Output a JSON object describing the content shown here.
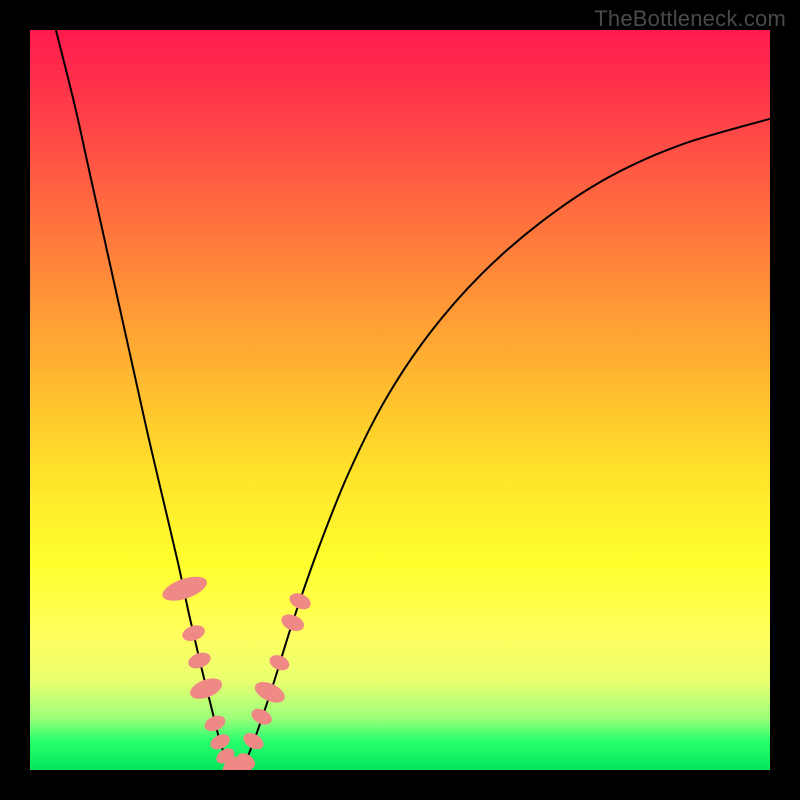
{
  "watermark": "TheBottleneck.com",
  "colors": {
    "background_frame": "#000000",
    "gradient_top": "#ff1a4d",
    "gradient_bottom": "#00e65c",
    "curve": "#000000",
    "marker": "#ef8985"
  },
  "chart_data": {
    "type": "line",
    "title": "",
    "xlabel": "",
    "ylabel": "",
    "xlim": [
      0,
      100
    ],
    "ylim": [
      0,
      100
    ],
    "series": [
      {
        "name": "left-curve",
        "x": [
          3.5,
          6,
          8,
          10,
          12,
          14,
          16,
          18,
          20,
          21.5,
          23,
          24.5,
          25.5,
          26.5,
          27.3
        ],
        "y": [
          100,
          90,
          81,
          72,
          63,
          54,
          45,
          36.5,
          28,
          21,
          14.5,
          8.5,
          4.5,
          1.5,
          0
        ]
      },
      {
        "name": "right-curve",
        "x": [
          28.5,
          29.5,
          31,
          33,
          35.5,
          39,
          43,
          48,
          54,
          61,
          69,
          78,
          88,
          100
        ],
        "y": [
          0,
          2,
          6,
          12,
          20,
          30,
          40,
          50,
          59,
          67,
          74,
          80,
          84.5,
          88
        ]
      }
    ],
    "floor_segment": {
      "x1": 27.3,
      "x2": 28.5,
      "y": 0
    },
    "markers_left_curve": [
      {
        "x": 20.9,
        "y": 24.5,
        "rx": 3.8,
        "ry": 9,
        "rot": 71
      },
      {
        "x": 22.1,
        "y": 18.5,
        "rx": 2.8,
        "ry": 4.5,
        "rot": 71
      },
      {
        "x": 22.9,
        "y": 14.8,
        "rx": 2.8,
        "ry": 4.5,
        "rot": 70
      },
      {
        "x": 23.8,
        "y": 11.0,
        "rx": 3.4,
        "ry": 6.5,
        "rot": 69
      },
      {
        "x": 25.0,
        "y": 6.3,
        "rx": 2.7,
        "ry": 4.2,
        "rot": 67
      },
      {
        "x": 25.7,
        "y": 3.8,
        "rx": 2.6,
        "ry": 4.0,
        "rot": 64
      },
      {
        "x": 26.4,
        "y": 1.9,
        "rx": 2.5,
        "ry": 3.8,
        "rot": 58
      }
    ],
    "markers_right_curve": [
      {
        "x": 29.2,
        "y": 1.2,
        "rx": 2.6,
        "ry": 3.8,
        "rot": -55
      },
      {
        "x": 30.2,
        "y": 3.9,
        "rx": 2.7,
        "ry": 4.2,
        "rot": -60
      },
      {
        "x": 31.3,
        "y": 7.2,
        "rx": 2.7,
        "ry": 4.2,
        "rot": -63
      },
      {
        "x": 32.4,
        "y": 10.5,
        "rx": 3.3,
        "ry": 6.2,
        "rot": -65
      },
      {
        "x": 33.7,
        "y": 14.5,
        "rx": 2.7,
        "ry": 4.0,
        "rot": -67
      },
      {
        "x": 35.5,
        "y": 19.9,
        "rx": 2.9,
        "ry": 4.6,
        "rot": -67
      },
      {
        "x": 36.5,
        "y": 22.8,
        "rx": 2.8,
        "ry": 4.3,
        "rot": -66
      }
    ],
    "markers_floor": [
      {
        "x": 27.1,
        "y": 0.3,
        "rx": 2.7,
        "ry": 4.8,
        "rot": 25
      },
      {
        "x": 28.1,
        "y": 0.1,
        "rx": 2.6,
        "ry": 4.6,
        "rot": 0
      },
      {
        "x": 28.9,
        "y": 0.3,
        "rx": 2.6,
        "ry": 4.4,
        "rot": -28
      }
    ]
  }
}
